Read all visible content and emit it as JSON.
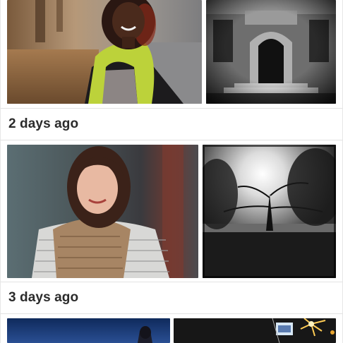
{
  "feed": {
    "sections": [
      {
        "label": "2 days ago"
      },
      {
        "label": "3 days ago"
      }
    ],
    "photos": [
      {
        "id": "p1",
        "description_icon": "portrait-photo",
        "tone": "color"
      },
      {
        "id": "p2",
        "description_icon": "building-entrance-photo",
        "tone": "black-and-white"
      },
      {
        "id": "p3",
        "description_icon": "portrait-photo",
        "tone": "color"
      },
      {
        "id": "p4",
        "description_icon": "tree-sunlight-photo",
        "tone": "black-and-white"
      },
      {
        "id": "p5",
        "description_icon": "night-sky-photo",
        "tone": "color"
      },
      {
        "id": "p6",
        "description_icon": "fireworks-photo",
        "tone": "color"
      }
    ]
  },
  "colors": {
    "header_text": "#2b2b2b",
    "divider": "#e3e3e3",
    "background": "#ffffff"
  }
}
